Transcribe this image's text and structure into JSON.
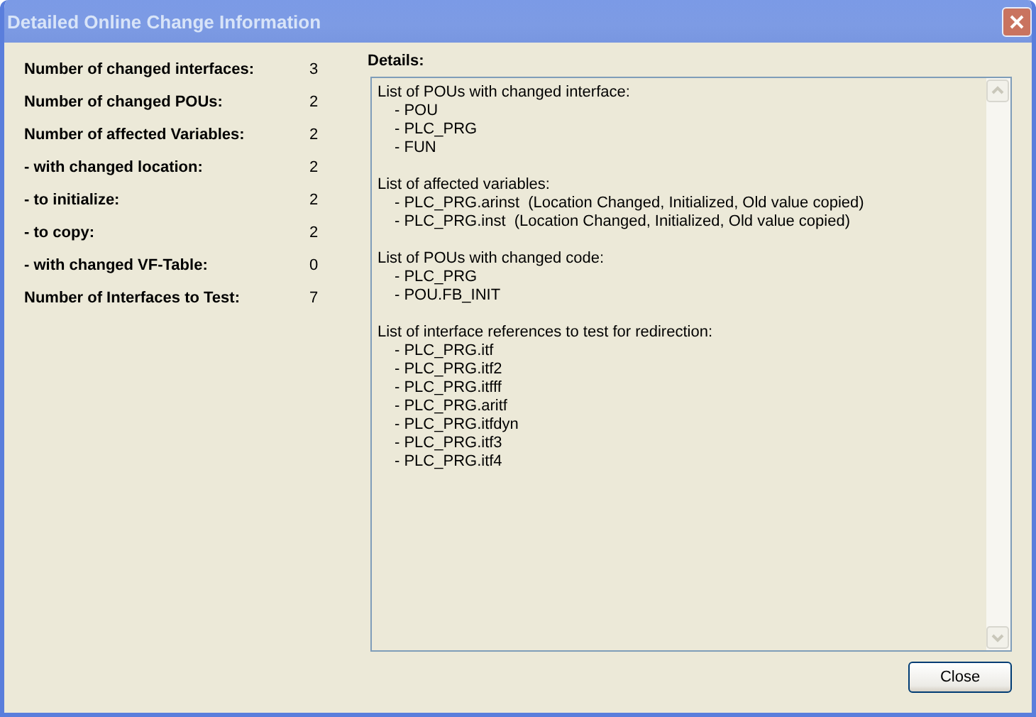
{
  "window": {
    "title": "Detailed Online Change Information"
  },
  "stats": [
    {
      "label": "Number of changed interfaces:",
      "value": "3"
    },
    {
      "label": "Number of changed POUs:",
      "value": "2"
    },
    {
      "label": "Number of affected Variables:",
      "value": "2"
    },
    {
      "label": "- with changed location:",
      "value": "2"
    },
    {
      "label": "- to initialize:",
      "value": "2"
    },
    {
      "label": "- to copy:",
      "value": "2"
    },
    {
      "label": "- with changed VF-Table:",
      "value": "0"
    },
    {
      "label": "Number of Interfaces to Test:",
      "value": "7"
    }
  ],
  "details": {
    "label": "Details:",
    "sections": [
      {
        "heading": "List of POUs with changed interface:",
        "items": [
          "- POU",
          "- PLC_PRG",
          "- FUN"
        ]
      },
      {
        "heading": "List of affected variables:",
        "items": [
          "- PLC_PRG.arinst  (Location Changed, Initialized, Old value copied)",
          "- PLC_PRG.inst  (Location Changed, Initialized, Old value copied)"
        ]
      },
      {
        "heading": "List of POUs with changed code:",
        "items": [
          "- PLC_PRG",
          "- POU.FB_INIT"
        ]
      },
      {
        "heading": "List of interface references to test for redirection:",
        "items": [
          "- PLC_PRG.itf",
          "- PLC_PRG.itf2",
          "- PLC_PRG.itfff",
          "- PLC_PRG.aritf",
          "- PLC_PRG.itfdyn",
          "- PLC_PRG.itf3",
          "- PLC_PRG.itf4"
        ]
      }
    ]
  },
  "buttons": [
    "Close"
  ]
}
